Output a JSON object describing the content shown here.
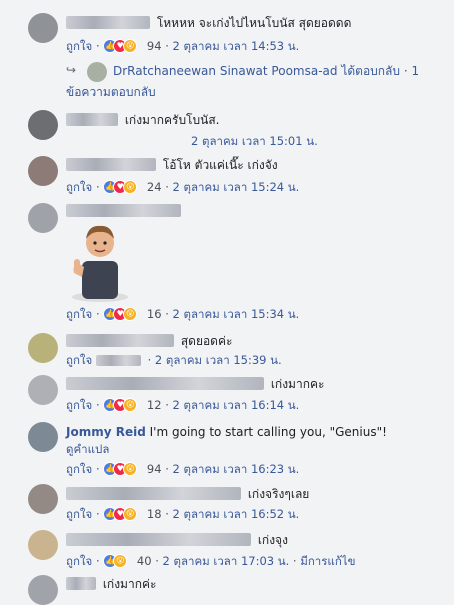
{
  "comments": [
    {
      "text": "โหหหห จะเก่งไปไหนโบนัส สุดยอดดด",
      "like": "ถูกใจ",
      "count": "94",
      "time": "2 ตุลาคม เวลา 14:53 น."
    },
    {
      "text": "เก่งมากครับโบนัส.",
      "time": "2 ตุลาคม เวลา 15:01 น."
    },
    {
      "text": "โอ้โห ตัวแค่เนี๊ะ เก่งจัง",
      "like": "ถูกใจ",
      "count": "24",
      "time": "2 ตุลาคม เวลา 15:24 น."
    },
    {
      "like": "ถูกใจ",
      "count": "16",
      "time": "2 ตุลาคม เวลา 15:34 น."
    },
    {
      "text": "สุดยอดค่ะ",
      "like": "ถูกใจ",
      "time": "2 ตุลาคม เวลา 15:39 น."
    },
    {
      "text": "เก่งมากคะ",
      "like": "ถูกใจ",
      "count": "12",
      "time": "2 ตุลาคม เวลา 16:14 น."
    },
    {
      "name": "Jommy Reid",
      "text": "I'm going to start calling you, \"Genius\"!",
      "translate": "ดูคำแปล",
      "like": "ถูกใจ",
      "count": "94",
      "time": "2 ตุลาคม เวลา 16:23 น."
    },
    {
      "text": "เก่งจริงๆเลย",
      "like": "ถูกใจ",
      "count": "18",
      "time": "2 ตุลาคม เวลา 16:52 น."
    },
    {
      "text": "เก่งจุง",
      "like": "ถูกใจ",
      "count": "40",
      "time": "2 ตุลาคม เวลา 17:03 น.",
      "edited": "มีการแก้ไข"
    },
    {
      "text": "เก่งมากค่ะ"
    }
  ],
  "reply": {
    "name": "DrRatchaneewan Sinawat Poomsa-ad",
    "text": "ได้ตอบกลับ · 1",
    "line2": "ข้อความตอบกลับ"
  },
  "separator": "·"
}
